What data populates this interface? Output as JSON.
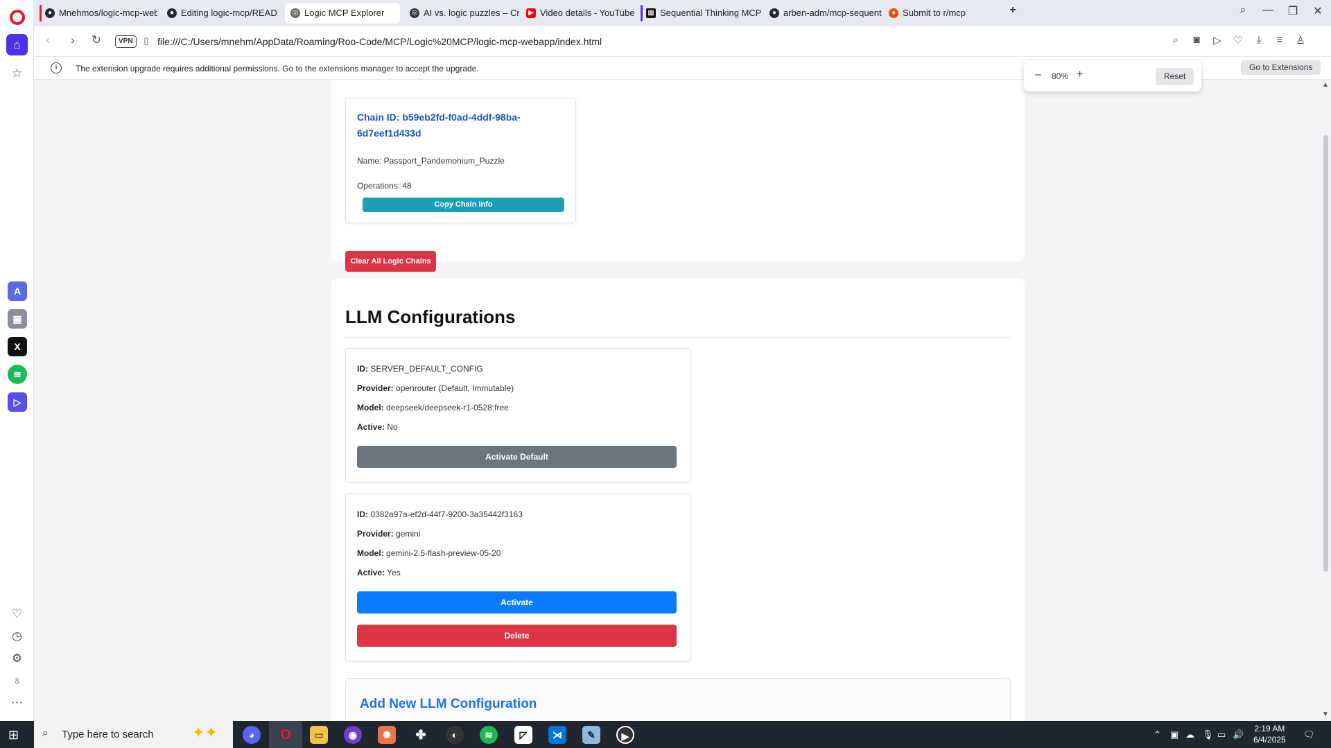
{
  "browser": {
    "tabs": [
      {
        "label": "Mnehmos/logic-mcp-web",
        "icon": "github-icon",
        "accent": "#e7182d"
      },
      {
        "label": "Editing logic-mcp/READM",
        "icon": "github-icon"
      },
      {
        "label": "Logic MCP Explorer",
        "icon": "globe-icon",
        "active": true
      },
      {
        "label": "AI vs. logic puzzles – Cruft",
        "icon": "globe-icon"
      },
      {
        "label": "Video details - YouTube St",
        "icon": "youtube-icon"
      },
      {
        "label": "Sequential Thinking MCP",
        "icon": "mcp-icon",
        "accent": "#4b32e6"
      },
      {
        "label": "arben-adm/mcp-sequenti",
        "icon": "github-icon"
      },
      {
        "label": "Submit to r/mcp",
        "icon": "reddit-icon"
      }
    ],
    "url": "file:///C:/Users/mnehm/AppData/Roaming/Roo-Code/MCP/Logic%20MCP/logic-mcp-webapp/index.html",
    "vpn_label": "VPN",
    "notification": {
      "message": "The extension upgrade requires additional permissions. Go to the extensions manager to accept the upgrade.",
      "button": "Go to Extensions"
    },
    "zoom": {
      "minus": "–",
      "value": "80%",
      "plus": "+",
      "reset": "Reset"
    }
  },
  "chain": {
    "id_text": "Chain ID: b59eb2fd-f0ad-4ddf-98ba-6d7eef1d433d",
    "name_text": "Name: Passport_Pandemonium_Puzzle",
    "operations_text": "Operations: 48",
    "copy_button": "Copy Chain Info",
    "clear_button": "Clear All Logic Chains"
  },
  "llm": {
    "title": "LLM Configurations",
    "labels": {
      "id": "ID:",
      "provider": "Provider:",
      "model": "Model:",
      "active": "Active:"
    },
    "configs": [
      {
        "id": "SERVER_DEFAULT_CONFIG",
        "provider": "openrouter (Default, Immutable)",
        "model": "deepseek/deepseek-r1-0528:free",
        "active": "No",
        "activate_button": "Activate Default"
      },
      {
        "id": "0382a97a-ef2d-44f7-9200-3a35442f3163",
        "provider": "gemini",
        "model": "gemini-2.5-flash-preview-05-20",
        "active": "Yes",
        "activate_button": "Activate",
        "delete_button": "Delete"
      }
    ],
    "add_title": "Add New LLM Configuration"
  },
  "taskbar": {
    "search_placeholder": "Type here to search",
    "time": "2:19 AM",
    "date": "6/4/2025"
  }
}
